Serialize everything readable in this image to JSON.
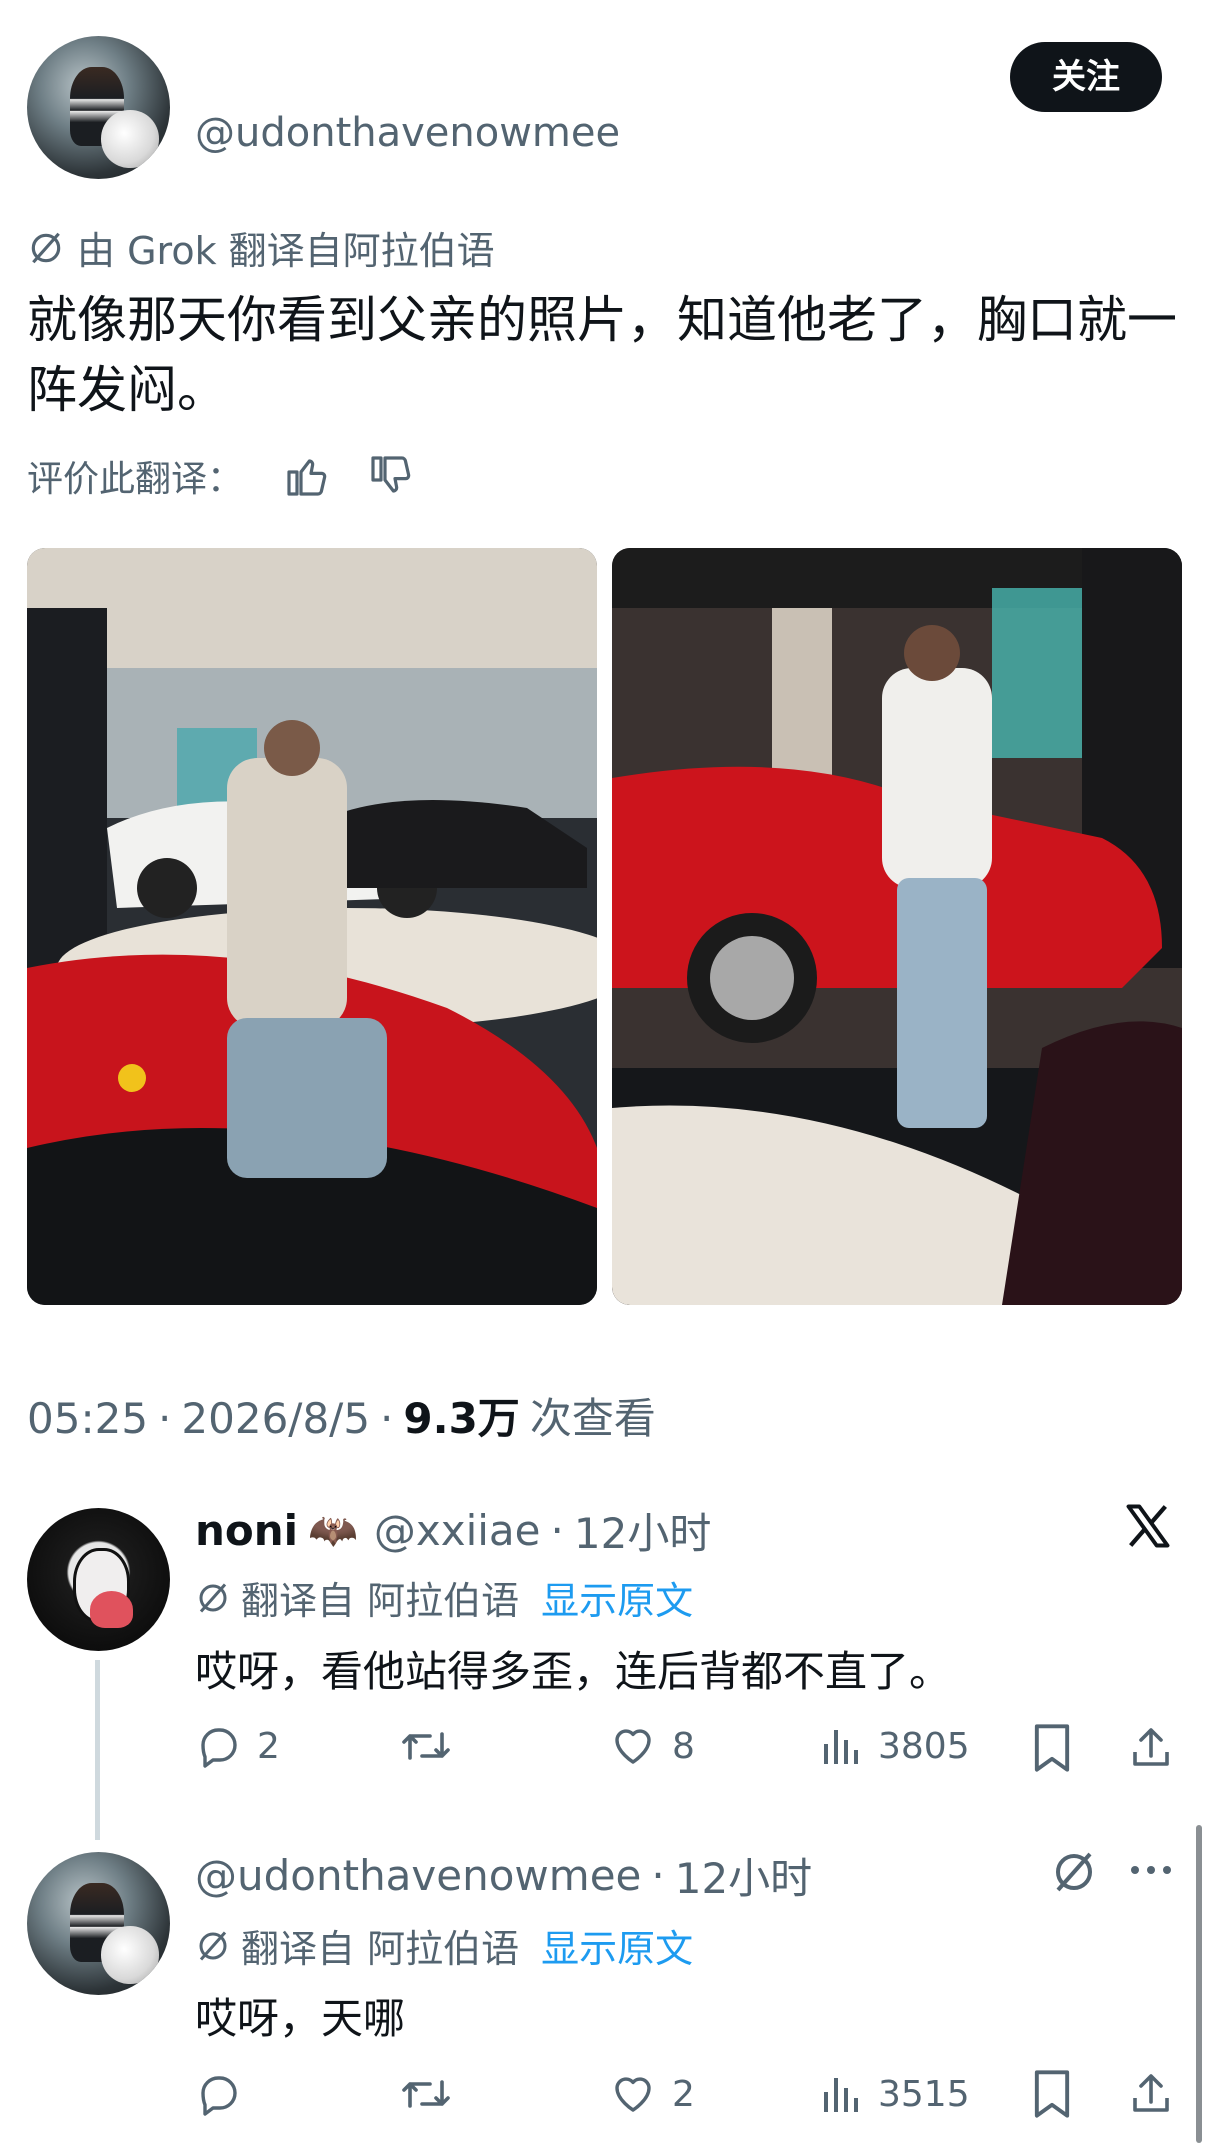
{
  "post": {
    "handle": "@udonthavenowmee",
    "follow_label": "关注",
    "translated_notice": "由 Grok 翻译自阿拉伯语",
    "text": "就像那天你看到父亲的照片，知道他老了，胸口就一阵发闷。",
    "rate_label": "评价此翻译：",
    "time": "05:25",
    "date": "2026/8/5",
    "views_count": "9.3万",
    "views_label": "次查看",
    "sep": "·"
  },
  "replies": [
    {
      "name": "noni",
      "emoji": "🦇",
      "handle": "@xxiiae",
      "time": "12小时",
      "translated_label": "翻译自 阿拉伯语",
      "show_original": "显示原文",
      "text": "哎呀，看他站得多歪，连后背都不直了。",
      "replies_count": "2",
      "reposts_count": "",
      "likes_count": "8",
      "views_count": "3805"
    },
    {
      "handle": "@udonthavenowmee",
      "time": "12小时",
      "translated_label": "翻译自 阿拉伯语",
      "show_original": "显示原文",
      "text": "哎呀，天哪",
      "replies_count": "",
      "reposts_count": "",
      "likes_count": "2",
      "views_count": "3515"
    }
  ],
  "icons": {
    "translate": "translate-icon",
    "thumbs_up": "thumbs-up-icon",
    "thumbs_down": "thumbs-down-icon",
    "x_logo": "x-logo-icon",
    "reply": "reply-icon",
    "repost": "repost-icon",
    "like": "heart-icon",
    "views": "views-icon",
    "bookmark": "bookmark-icon",
    "share": "share-icon",
    "more": "more-icon"
  },
  "colors": {
    "text": "#0f1419",
    "secondary": "#536471",
    "link": "#1d9bf0",
    "button": "#0f1419"
  }
}
